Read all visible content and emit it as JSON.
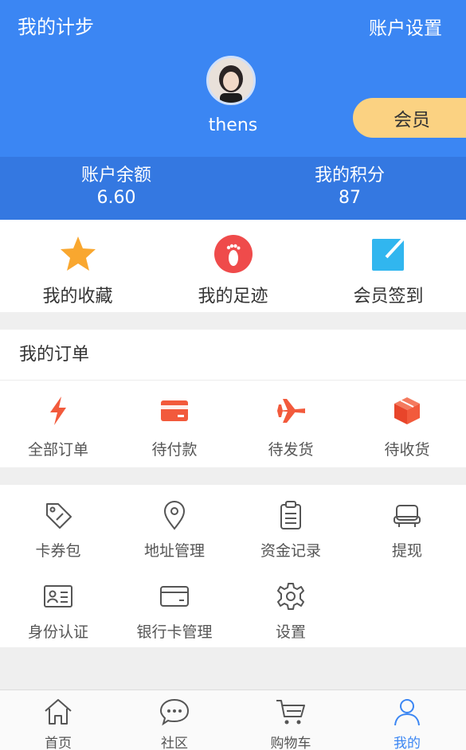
{
  "header": {
    "title": "我的计步",
    "settings_link": "账户设置",
    "username": "thens",
    "vip_label": "会员",
    "bg_color": "#3b86f3"
  },
  "balance": {
    "account_label": "账户余额",
    "account_value": "6.60",
    "points_label": "我的积分",
    "points_value": "87"
  },
  "quick": [
    {
      "label": "我的收藏",
      "icon": "star-icon"
    },
    {
      "label": "我的足迹",
      "icon": "footprint-icon"
    },
    {
      "label": "会员签到",
      "icon": "checkin-icon"
    }
  ],
  "orders": {
    "title": "我的订单",
    "items": [
      {
        "label": "全部订单",
        "icon": "lightning-icon"
      },
      {
        "label": "待付款",
        "icon": "card-icon"
      },
      {
        "label": "待发货",
        "icon": "plane-icon"
      },
      {
        "label": "待收货",
        "icon": "box-icon"
      }
    ],
    "accent": "#f25a3c"
  },
  "services": [
    {
      "label": "卡券包",
      "icon": "coupon-icon"
    },
    {
      "label": "地址管理",
      "icon": "location-icon"
    },
    {
      "label": "资金记录",
      "icon": "clipboard-icon"
    },
    {
      "label": "提现",
      "icon": "withdraw-icon"
    },
    {
      "label": "身份认证",
      "icon": "id-card-icon"
    },
    {
      "label": "银行卡管理",
      "icon": "bank-card-icon"
    },
    {
      "label": "设置",
      "icon": "gear-icon"
    }
  ],
  "nav": [
    {
      "label": "首页",
      "icon": "home-icon"
    },
    {
      "label": "社区",
      "icon": "chat-icon"
    },
    {
      "label": "购物车",
      "icon": "cart-icon"
    },
    {
      "label": "我的",
      "icon": "user-icon",
      "active": true
    }
  ]
}
